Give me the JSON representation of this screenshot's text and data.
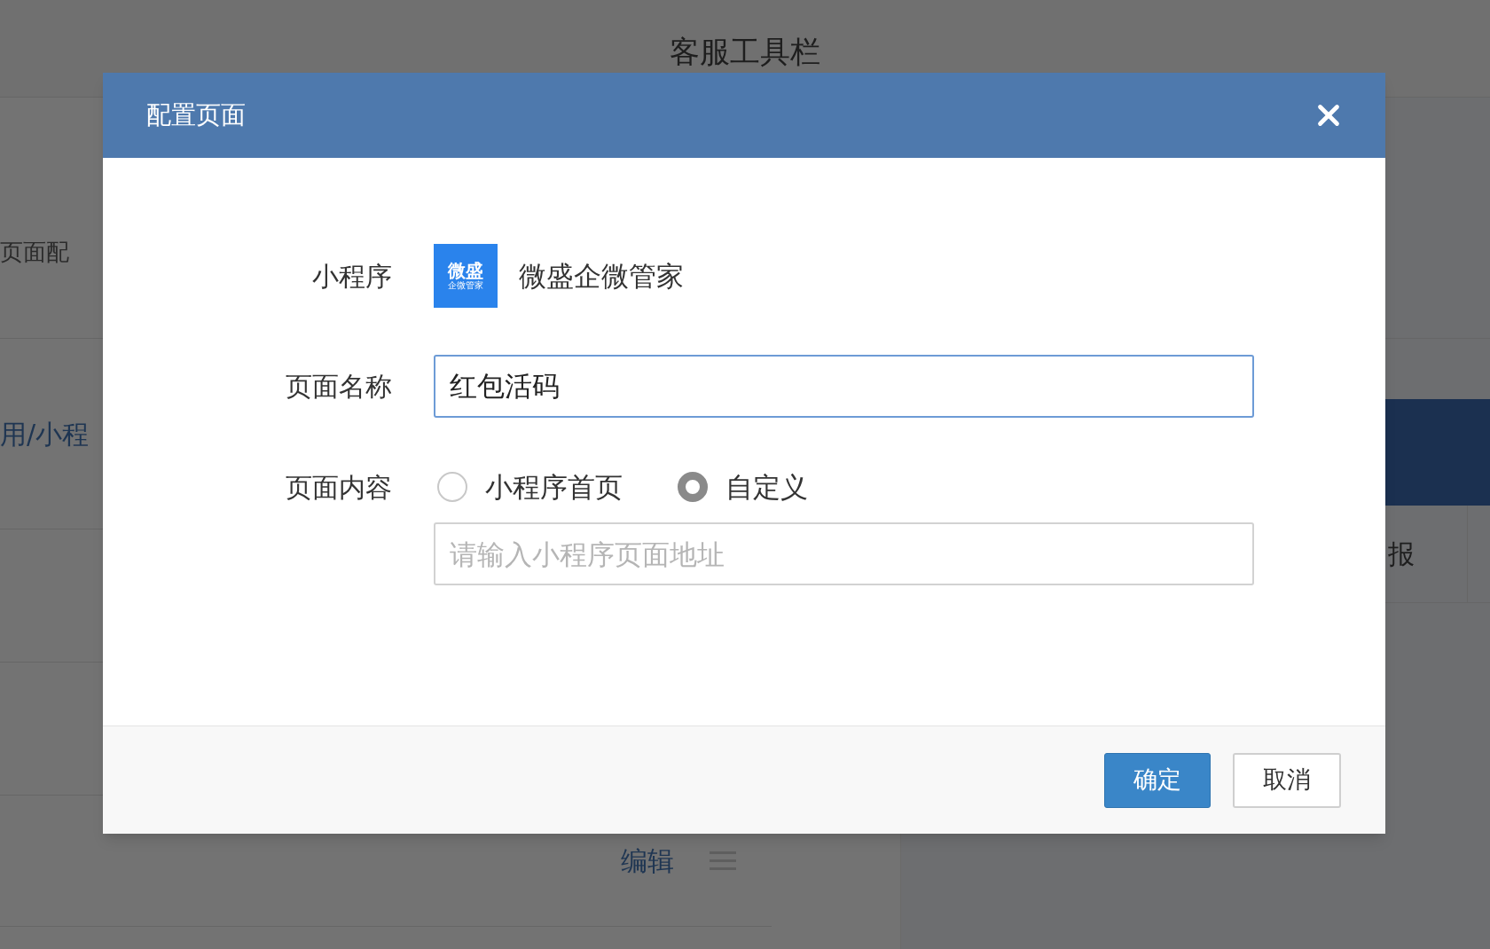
{
  "page": {
    "title": "客服工具栏",
    "left_texts": [
      "页面配",
      "用/小程"
    ],
    "right_cells": [
      "报"
    ],
    "edit_link": "编辑"
  },
  "dialog": {
    "title": "配置页面",
    "mini_program": {
      "label": "小程序",
      "logo_title": "微盛",
      "logo_subtitle": "企微管家",
      "name": "微盛企微管家"
    },
    "page_name": {
      "label": "页面名称",
      "value": "红包活码"
    },
    "page_content": {
      "label": "页面内容",
      "options": [
        {
          "label": "小程序首页",
          "selected": false
        },
        {
          "label": "自定义",
          "selected": true
        }
      ],
      "address_placeholder": "请输入小程序页面地址"
    },
    "buttons": [
      {
        "label": "确定",
        "kind": "primary"
      },
      {
        "label": "取消",
        "kind": "secondary"
      }
    ]
  }
}
